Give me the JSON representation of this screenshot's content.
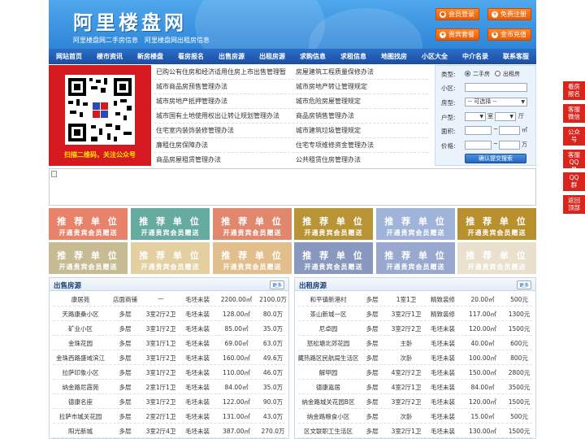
{
  "header": {
    "logo": "阿里楼盘网",
    "taglines": [
      "阿里楼盘网二手房信息",
      "阿里楼盘网出租房信息"
    ],
    "buttons": [
      {
        "label": "会员登录",
        "icon": "user-icon"
      },
      {
        "label": "免费注册",
        "icon": "register-icon"
      },
      {
        "label": "贵宾套餐",
        "icon": "vip-icon"
      },
      {
        "label": "金币充值",
        "icon": "coin-icon"
      }
    ]
  },
  "nav": [
    "网站首页",
    "楼市资讯",
    "新房楼盘",
    "看房报名",
    "出售房源",
    "出租房源",
    "求购信息",
    "求租信息",
    "地图找房",
    "小区大全",
    "中介名录",
    "联系客服"
  ],
  "qr": {
    "caption": "扫描二维码，关注公众号"
  },
  "links": {
    "left": [
      "已购公有住房和经济适用住房上市出售管理暂",
      "城市商品房预售管理办法",
      "城市房地产抵押管理办法",
      "城市国有土地使用权出让转让规划管理办法",
      "住宅室内装饰装修管理办法",
      "廉租住房保障办法",
      "商品房屋租赁管理办法"
    ],
    "right": [
      "房屋建筑工程质量保修办法",
      "城市房地产转让管理规定",
      "城市危险房屋管理规定",
      "商品房销售管理办法",
      "城市建筑垃圾管理规定",
      "住宅专项维修资金管理办法",
      "公共租赁住房管理办法"
    ]
  },
  "search": {
    "type_label": "类型:",
    "type_options": [
      "二手房",
      "出租房"
    ],
    "type_selected": "二手房",
    "community_label": "小区:",
    "community_value": "",
    "house_type_label": "房型:",
    "house_type_value": "-- 可选择 --",
    "layout_label": "户型:",
    "room_unit": "室",
    "hall_unit": "厅",
    "area_label": "面积:",
    "area_unit": "㎡",
    "range_sep": "~",
    "price_label": "价格:",
    "price_unit": "万",
    "submit": "确认提交搜索"
  },
  "recommend": {
    "line1": "推 荐 单 位",
    "line2": "开通贵宾会员赠送",
    "colors": [
      "#e8826a",
      "#65aba0",
      "#e0876d",
      "#b99435",
      "#9fb4d8",
      "#b9902e",
      "#c7bb94",
      "#e3cfa0",
      "#e2be8c",
      "#8898be",
      "#98a8cf",
      "#e9e1cd"
    ]
  },
  "sale": {
    "title": "出售房源",
    "more": "更多",
    "rows": [
      [
        "康居苑",
        "店面商铺",
        "—",
        "毛坯未装",
        "2200.00㎡",
        "2100.0万"
      ],
      [
        "天路康桑小区",
        "多层",
        "3室2厅2卫",
        "毛坯未装",
        "128.00㎡",
        "80.0万"
      ],
      [
        "矿业小区",
        "多层",
        "3室1厅2卫",
        "毛坯未装",
        "85.00㎡",
        "35.0万"
      ],
      [
        "金珠花园",
        "多层",
        "3室1厅1卫",
        "毛坯未装",
        "69.00㎡",
        "63.0万"
      ],
      [
        "金珠西路盛域滨江",
        "多层",
        "3室1厅2卫",
        "毛坯未装",
        "160.00㎡",
        "49.6万"
      ],
      [
        "拉萨印象小区",
        "多层",
        "3室1厅2卫",
        "毛坯未装",
        "110.00㎡",
        "46.0万"
      ],
      [
        "纳金路尼霞苑",
        "多层",
        "2室1厅1卫",
        "毛坯未装",
        "84.00㎡",
        "35.0万"
      ],
      [
        "德康名座",
        "多层",
        "3室1厅2卫",
        "毛坯未装",
        "122.00㎡",
        "90.0万"
      ],
      [
        "拉萨市城关花园",
        "多层",
        "2室2厅1卫",
        "毛坯未装",
        "131.00㎡",
        "43.0万"
      ],
      [
        "阳光新城",
        "多层",
        "3室2厅4卫",
        "毛坯未装",
        "387.00㎡",
        "270.0万"
      ]
    ]
  },
  "rent": {
    "title": "出租房源",
    "more": "更多",
    "rows": [
      [
        "和平镇新港村",
        "多层",
        "1室1卫",
        "精致装修",
        "20.00㎡",
        "500元"
      ],
      [
        "茶山新城一区",
        "多层",
        "3室2厅1卫",
        "精致装修",
        "117.00㎡",
        "1300元"
      ],
      [
        "尼卓园",
        "多层",
        "3室2厅2卫",
        "毛坯未装",
        "120.00㎡",
        "1500元"
      ],
      [
        "怒松塘北郊花园",
        "多层",
        "主卧",
        "毛坯未装",
        "40.00㎡",
        "600元"
      ],
      [
        "藏热路区民航局生活区",
        "多层",
        "次卧",
        "毛坯未装",
        "100.00㎡",
        "800元"
      ],
      [
        "解甲园",
        "多层",
        "4室2厅2卫",
        "毛坯未装",
        "150.00㎡",
        "2800元"
      ],
      [
        "德康嘉居",
        "多层",
        "4室2厅1卫",
        "毛坯未装",
        "84.00㎡",
        "3500元"
      ],
      [
        "纳金路城关花园B区",
        "多层",
        "3室2厅2卫",
        "毛坯未装",
        "120.00㎡",
        "1500元"
      ],
      [
        "纳金路粮食小区",
        "多层",
        "次卧",
        "毛坯未装",
        "15.00㎡",
        "500元"
      ],
      [
        "区文联职工生活区",
        "多层",
        "3室2厅1卫",
        "毛坯未装",
        "130.00㎡",
        "1500元"
      ]
    ]
  },
  "side": [
    "看房报名",
    "客服微信",
    "公众号",
    "客服QQ号",
    "QQ群",
    "返回顶部"
  ]
}
